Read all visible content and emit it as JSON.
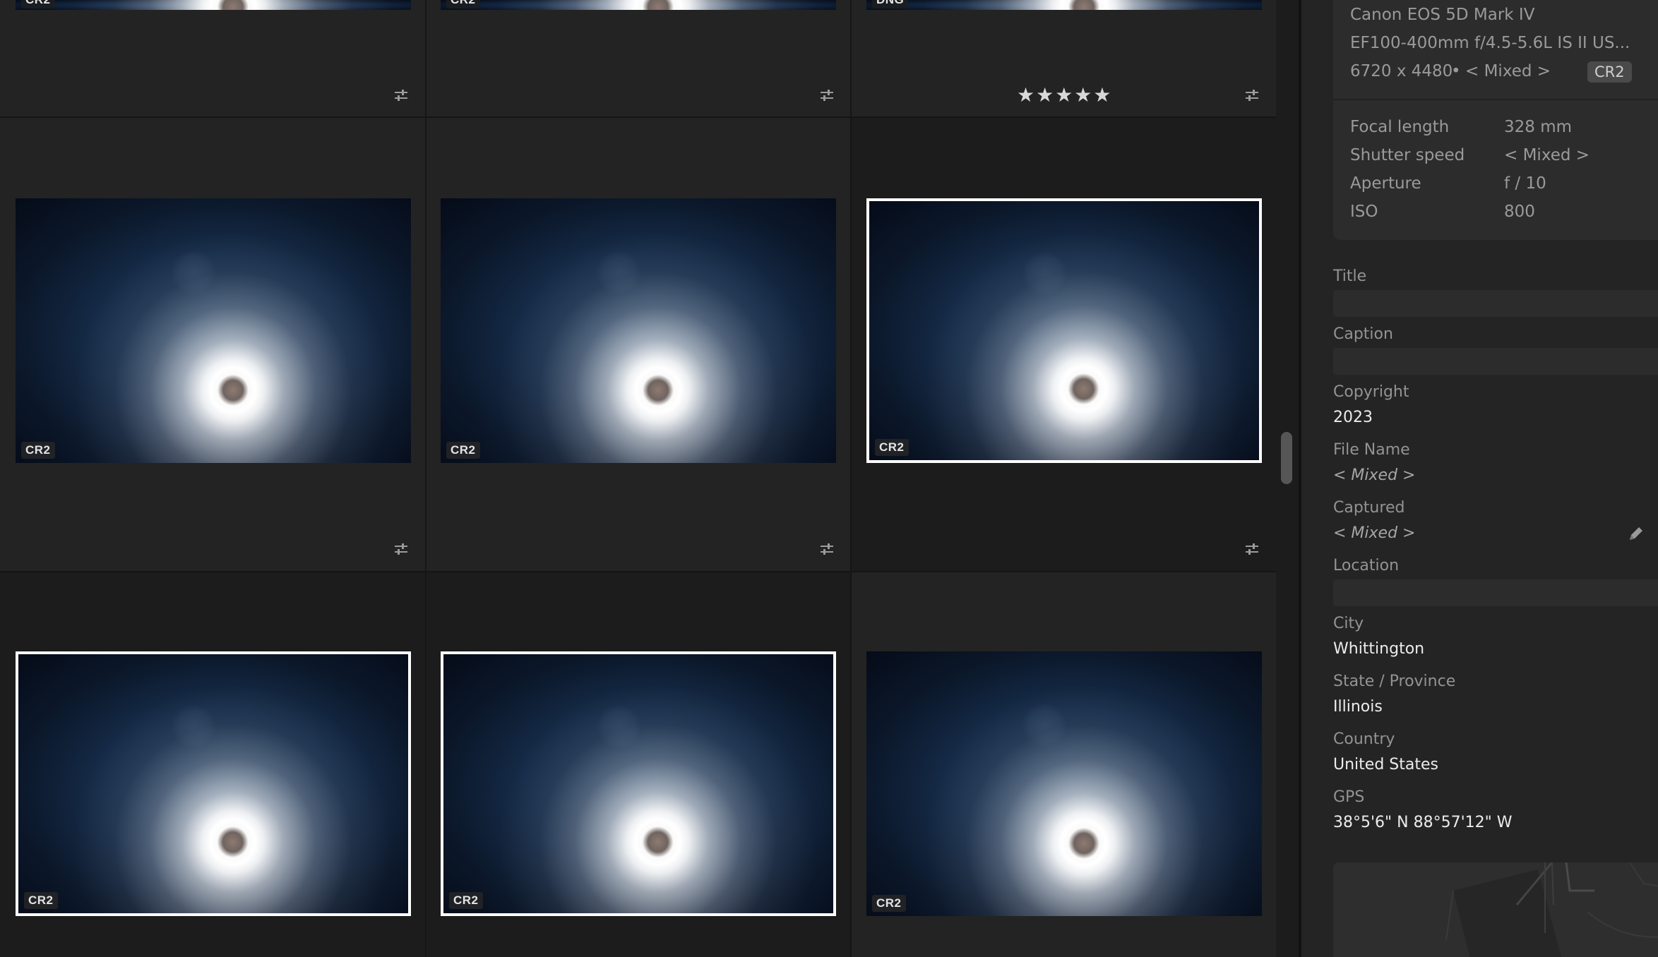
{
  "grid": {
    "format_label": "CR2",
    "top_row": [
      {
        "format": "CR2"
      },
      {
        "format": "CR2"
      },
      {
        "format": "DNG",
        "rating": "★★★★★"
      }
    ],
    "rows": [
      [
        {
          "format": "CR2",
          "selected": false
        },
        {
          "format": "CR2",
          "selected": false
        },
        {
          "format": "CR2",
          "selected": true
        }
      ],
      [
        {
          "format": "CR2",
          "selected": true
        },
        {
          "format": "CR2",
          "selected": true
        },
        {
          "format": "CR2",
          "selected": false
        }
      ]
    ]
  },
  "panel": {
    "camera": "Canon EOS 5D Mark IV",
    "lens": "EF100-400mm f/4.5-5.6L IS II US...",
    "dimensions": "6720 x 4480",
    "separator": "•",
    "dimensions_extra": "< Mixed >",
    "format_badge": "CR2",
    "exif": [
      {
        "label": "Focal length",
        "value": "328 mm"
      },
      {
        "label": "Shutter speed",
        "value": "< Mixed >"
      },
      {
        "label": "Aperture",
        "value": "f / 10"
      },
      {
        "label": "ISO",
        "value": "800"
      }
    ],
    "title_label": "Title",
    "caption_label": "Caption",
    "copyright_label": "Copyright",
    "copyright_value": "2023",
    "filename_label": "File Name",
    "filename_value": "< Mixed >",
    "captured_label": "Captured",
    "captured_value": "< Mixed >",
    "location_label": "Location",
    "city_label": "City",
    "city_value": "Whittington",
    "state_label": "State / Province",
    "state_value": "Illinois",
    "country_label": "Country",
    "country_value": "United States",
    "gps_label": "GPS",
    "gps_value": "38°5'6\" N 88°57'12\" W"
  },
  "icons": {
    "edit": "sliders-icon",
    "pencil": "pencil-icon"
  }
}
